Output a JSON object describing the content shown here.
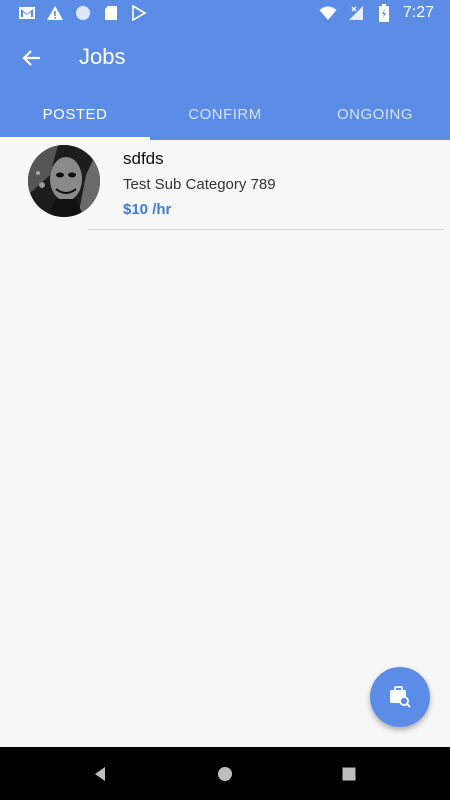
{
  "status_bar": {
    "time": "7:27",
    "left_icons": [
      "gmail-icon",
      "warning-icon",
      "circle-icon",
      "sd-card-icon",
      "play-store-icon"
    ],
    "right_icons": [
      "wifi-icon",
      "signal-icon",
      "battery-icon"
    ]
  },
  "toolbar": {
    "title": "Jobs",
    "back_icon": "arrow-back-icon"
  },
  "tabs": [
    {
      "label": "POSTED",
      "active": true
    },
    {
      "label": "CONFIRM",
      "active": false
    },
    {
      "label": "ONGOING",
      "active": false
    }
  ],
  "jobs": [
    {
      "title": "sdfds",
      "subcategory": "Test Sub Category 789",
      "price": "$10 /hr"
    }
  ],
  "fab": {
    "icon": "briefcase-search-icon"
  },
  "nav": {
    "icons": [
      "back-triangle-icon",
      "home-circle-icon",
      "recents-square-icon"
    ]
  },
  "colors": {
    "primary": "#5b8ce6",
    "price": "#3d7bdc",
    "background": "#f7f7f7"
  }
}
